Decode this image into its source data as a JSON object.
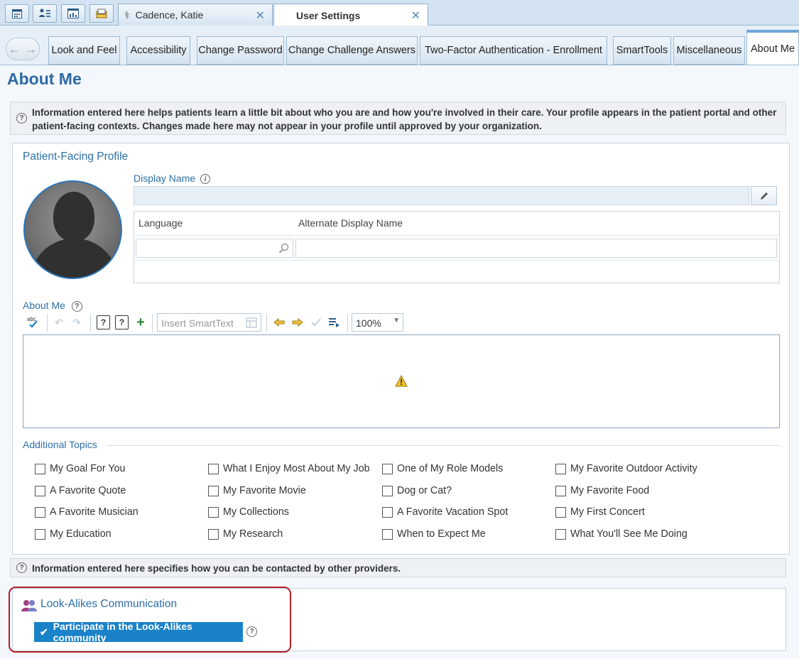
{
  "top_tabs": {
    "icons": [
      "calendar-icon",
      "patient-list-icon",
      "dashboard-icon",
      "inbasket-icon"
    ],
    "patient_tab_label": "Cadence, Katie",
    "settings_tab_label": "User Settings",
    "close_glyph": "✕"
  },
  "sub_tabs": [
    {
      "label": "Look and Feel"
    },
    {
      "label": "Accessibility"
    },
    {
      "label": "Change Password"
    },
    {
      "label": "Change Challenge Answers"
    },
    {
      "label": "Two-Factor Authentication - Enrollment"
    },
    {
      "label": "SmartTools"
    },
    {
      "label": "Miscellaneous"
    },
    {
      "label": "About Me"
    }
  ],
  "page_title": "About Me",
  "info_top": "Information entered here helps patients learn a little bit about who you are and how you're involved in their care. Your profile appears in the patient portal and other patient-facing contexts. Changes made here may not appear in your profile until approved by your organization.",
  "profile": {
    "section_title": "Patient-Facing Profile",
    "display_name_label": "Display Name",
    "display_name_value": "",
    "lang_header": "Language",
    "alt_header": "Alternate Display Name",
    "lang_value": "",
    "alt_value": ""
  },
  "about_me": {
    "label": "About Me",
    "insert_smarttext_placeholder": "Insert SmartText",
    "zoom": "100%"
  },
  "additional_topics": {
    "label": "Additional Topics",
    "items": [
      "My Goal For You",
      "What I Enjoy Most About My Job",
      "One of My Role Models",
      "My Favorite Outdoor Activity",
      "A Favorite Quote",
      "My Favorite Movie",
      "Dog or Cat?",
      "My Favorite Food",
      "A Favorite Musician",
      "My Collections",
      "A Favorite Vacation Spot",
      "My First Concert",
      "My Education",
      "My Research",
      "When to Expect Me",
      "What You'll See Me Doing"
    ]
  },
  "info_contact": "Information entered here specifies how you can be contacted by other providers.",
  "lookalikes": {
    "title": "Look-Alikes Communication",
    "participate_label": "Participate in the Look-Alikes community",
    "participate_checked": true
  },
  "colors": {
    "accent": "#2e6fa7",
    "highlight": "#b3202b",
    "button": "#1a82c8"
  }
}
